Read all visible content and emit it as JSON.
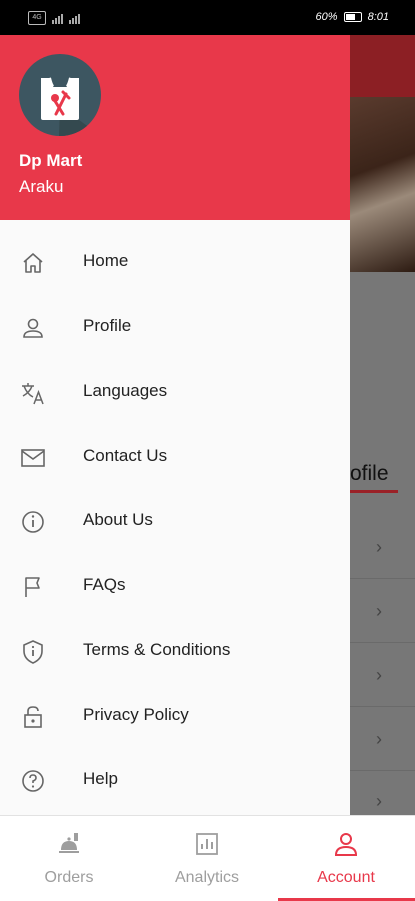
{
  "status_bar": {
    "sim_label": "VoLTE",
    "battery": "60%",
    "time": "8:01"
  },
  "drawer": {
    "shop_name": "Dp Mart",
    "shop_location": "Araku",
    "items": [
      {
        "label": "Home",
        "icon": "home-icon"
      },
      {
        "label": "Profile",
        "icon": "person-icon"
      },
      {
        "label": "Languages",
        "icon": "translate-icon"
      },
      {
        "label": "Contact Us",
        "icon": "mail-icon"
      },
      {
        "label": "About Us",
        "icon": "info-icon"
      },
      {
        "label": "FAQs",
        "icon": "flag-icon"
      },
      {
        "label": "Terms & Conditions",
        "icon": "shield-icon"
      },
      {
        "label": "Privacy Policy",
        "icon": "lock-icon"
      },
      {
        "label": "Help",
        "icon": "help-icon"
      }
    ]
  },
  "background": {
    "tab_label": "ofile"
  },
  "bottom_nav": {
    "tabs": [
      {
        "label": "Orders",
        "icon": "orders-icon"
      },
      {
        "label": "Analytics",
        "icon": "analytics-icon"
      },
      {
        "label": "Account",
        "icon": "account-icon"
      }
    ],
    "active": "Account"
  },
  "colors": {
    "brand": "#e8384a",
    "logo_bg": "#3d5661",
    "dim_header": "#8c1f24"
  }
}
